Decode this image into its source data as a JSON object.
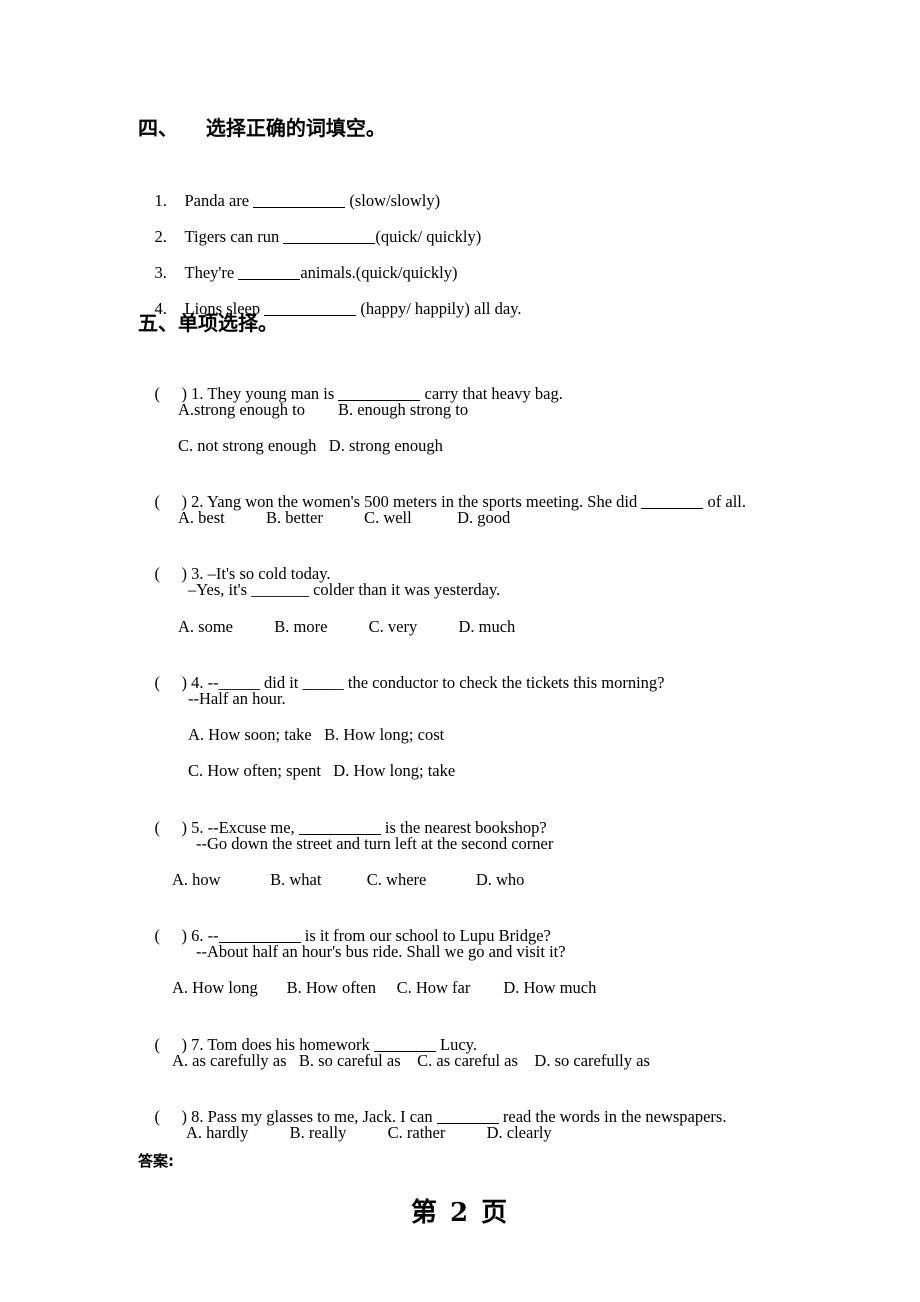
{
  "page": {
    "background_color": "#ffffff",
    "text_color": "#000000",
    "footer": "第 2 页",
    "answer_label": "答案:"
  },
  "section_four": {
    "heading_number": "四、",
    "heading_title": "选择正确的词填空。",
    "heading_full": "四、    选择正确的词填空。",
    "items": [
      {
        "number": "1.",
        "before": "Panda are ",
        "blank": "__________",
        "after": " (slow/slowly)"
      },
      {
        "number": "2.",
        "before": "Tigers can run ",
        "blank": "__________",
        "after": "(quick/ quickly)"
      },
      {
        "number": "3.",
        "before": "They're ",
        "blank": "_______",
        "after": "animals.(quick/quickly)"
      },
      {
        "number": "4.",
        "before": "Lions sleep ",
        "blank": "__________",
        "after": " (happy/ happily) all day."
      }
    ]
  },
  "section_five": {
    "heading_number": "五、",
    "heading_title": "单项选择。",
    "heading_full": "五、单项选择。",
    "questions": [
      {
        "marker_open": "(",
        "marker_close": ")",
        "stem_before": " 1. They young man is ",
        "stem_blank": "_______",
        "stem_after": " carry that heavy bag.",
        "sub_lines": [],
        "option_lines": [
          "A.strong enough to        B. enough strong to",
          "C. not strong enough   D. strong enough"
        ]
      },
      {
        "marker_open": "(",
        "marker_close": ")",
        "stem_before": " 2. Yang won the women's 500 meters in the sports meeting. She did ",
        "stem_blank": "_______",
        "stem_after": " of all.",
        "sub_lines": [],
        "option_lines": [
          "A. best          B. better          C. well           D. good"
        ]
      },
      {
        "marker_open": "(",
        "marker_close": ")",
        "stem_before": " 3. –It's so cold today.",
        "stem_blank": "",
        "stem_after": "",
        "sub_lines": [
          "–Yes, it's _______ colder than it was yesterday."
        ],
        "option_lines": [
          "A. some          B. more          C. very          D. much"
        ]
      },
      {
        "marker_open": "(",
        "marker_close": ")",
        "stem_before": " 4. --_____ did it _____ the conductor to check the tickets this morning?",
        "stem_blank": "",
        "stem_after": "",
        "sub_lines": [
          "--Half an hour."
        ],
        "option_lines": [
          "A. How soon; take   B. How long; cost",
          "C. How often; spent   D. How long; take"
        ]
      },
      {
        "marker_open": "(",
        "marker_close": ")",
        "stem_before": " 5. --Excuse me, ",
        "stem_blank": "_______",
        "stem_after": " is the nearest bookshop?",
        "sub_lines": [
          "--Go down the street and turn left at the second corner"
        ],
        "option_lines": [
          "A. how            B. what           C. where            D. who"
        ]
      },
      {
        "marker_open": "(",
        "marker_close": ")",
        "stem_before": " 6. --",
        "stem_blank": "_______",
        "stem_after": " is it from our school to Lupu Bridge?",
        "sub_lines": [
          "--About half an hour's bus ride. Shall we go and visit it?"
        ],
        "option_lines": [
          "A. How long       B. How often     C. How far        D. How much"
        ]
      },
      {
        "marker_open": "(",
        "marker_close": ")",
        "stem_before": " 7. Tom does his homework ",
        "stem_blank": "_______",
        "stem_after": " Lucy.",
        "sub_lines": [],
        "option_lines": [
          "A. as carefully as   B. so careful as    C. as careful as    D. so carefully as"
        ]
      },
      {
        "marker_open": "(",
        "marker_close": ")",
        "stem_before": " 8. Pass my glasses to me, Jack. I can ",
        "stem_blank": "_______",
        "stem_after": " read the words in the newspapers.",
        "sub_lines": [],
        "option_lines": [
          "A. hardly          B. really          C. rather          D. clearly"
        ]
      }
    ]
  }
}
